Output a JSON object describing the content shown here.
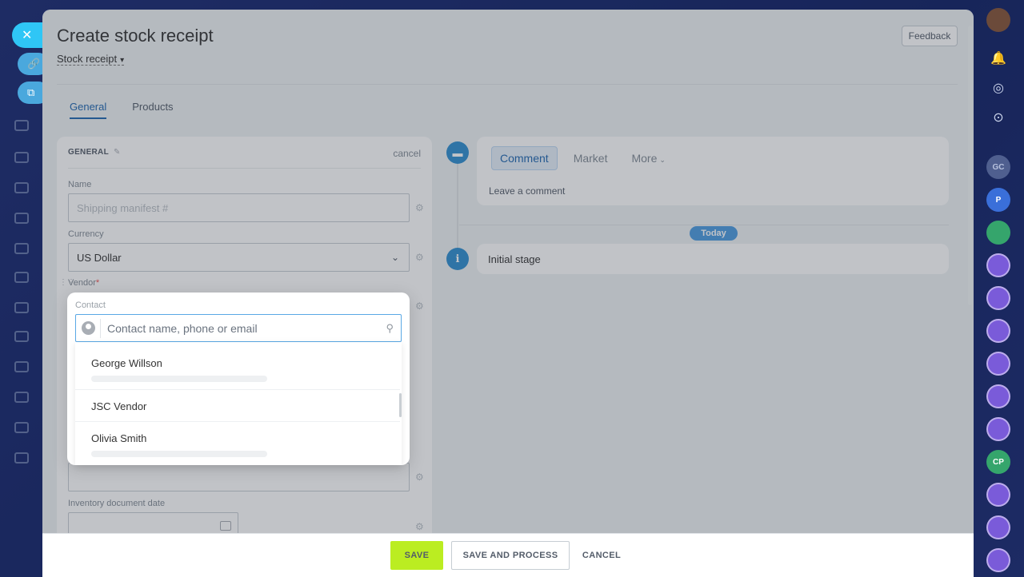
{
  "page": {
    "title": "Create stock receipt",
    "doc_type": "Stock receipt",
    "feedback": "Feedback"
  },
  "tabs": [
    {
      "label": "General",
      "active": true
    },
    {
      "label": "Products",
      "active": false
    }
  ],
  "card": {
    "section_title": "GENERAL",
    "cancel": "cancel",
    "fields": {
      "name_label": "Name",
      "name_placeholder": "Shipping manifest #",
      "currency_label": "Currency",
      "currency_value": "US Dollar",
      "vendor_label": "Vendor",
      "vendor_required": "*",
      "inventory_date_label": "Inventory document date"
    }
  },
  "timeline": {
    "comment_tabs": [
      "Comment",
      "Market",
      "More"
    ],
    "leave_comment": "Leave a comment",
    "today": "Today",
    "stage": "Initial stage"
  },
  "popup": {
    "label": "Contact",
    "placeholder": "Contact name, phone or email",
    "items": [
      {
        "name": "George Willson"
      },
      {
        "name": "JSC Vendor"
      },
      {
        "name": "Olivia Smith"
      }
    ]
  },
  "footer": {
    "save": "SAVE",
    "save_process": "SAVE AND PROCESS",
    "cancel": "CANCEL"
  },
  "rail": {
    "avatars": [
      "GC",
      "P",
      "CP"
    ]
  },
  "colors": {
    "accent": "#2067b0",
    "save_button": "#bbed21",
    "timeline_icon": "#2f8fd0",
    "today_badge": "#4b9be0"
  }
}
